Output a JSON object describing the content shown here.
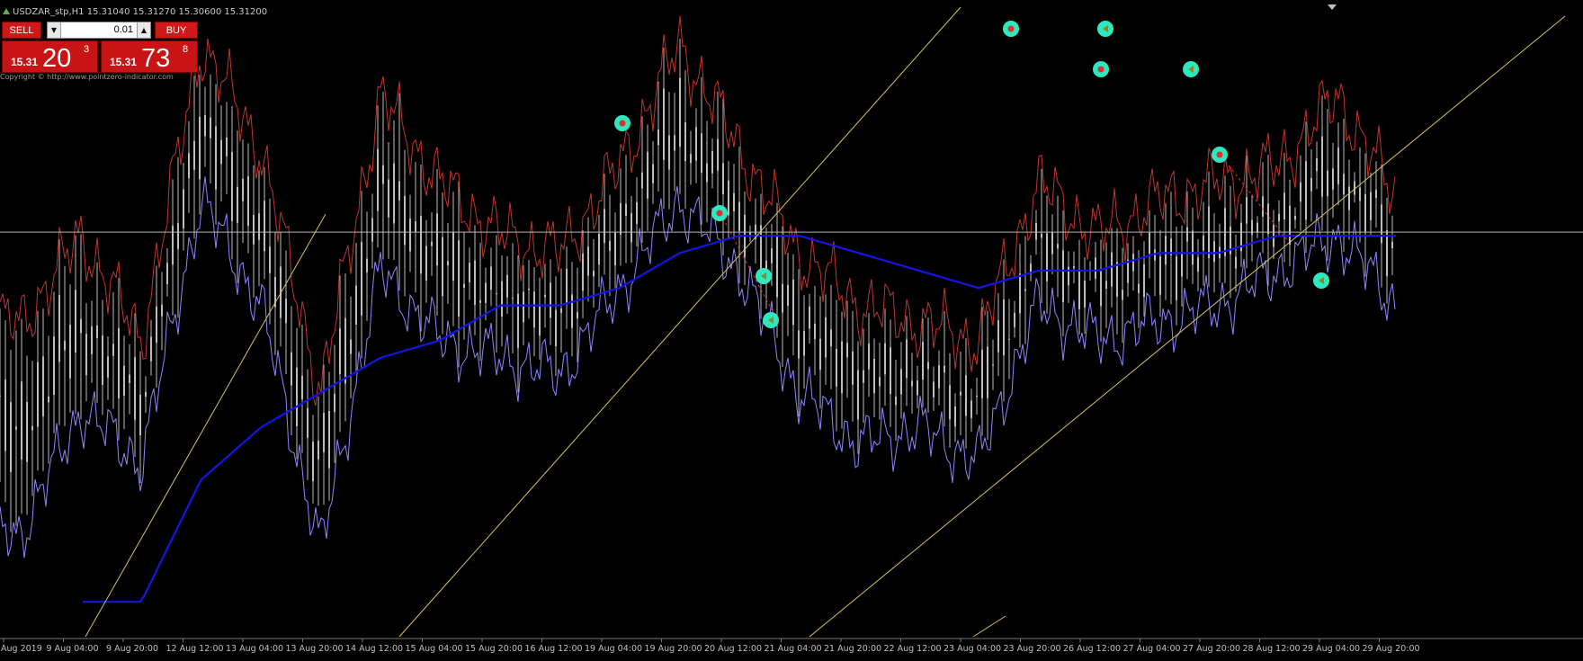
{
  "header": {
    "symbol_line": "USDZAR_stp,H1  15.31040 15.31270 15.30600 15.31200",
    "copyright": "Copyright © http://www.pointzero-indicator.com"
  },
  "trade_panel": {
    "sell_label": "SELL",
    "buy_label": "BUY",
    "lot_value": "0.01",
    "bid_prefix": "15.31",
    "bid_big": "20",
    "bid_sup": "3",
    "ask_prefix": "15.31",
    "ask_big": "73",
    "ask_sup": "8"
  },
  "colors": {
    "background": "#000000",
    "candles": "#bdbdbd",
    "upper_band": "#c0352b",
    "lower_band": "#8e86ff",
    "moving_average": "#1414e6",
    "trendlines": "#d8c35a",
    "signal_marker": "#2ee8c0",
    "signal_dot": "#e03030",
    "current_price_line": "#b4b4b4"
  },
  "chart_data": {
    "type": "line",
    "symbol": "USDZAR_stp",
    "timeframe": "H1",
    "x_ticks": [
      "Aug 2019",
      "9 Aug 04:00",
      "9 Aug 20:00",
      "12 Aug 12:00",
      "13 Aug 04:00",
      "13 Aug 20:00",
      "14 Aug 12:00",
      "15 Aug 04:00",
      "15 Aug 20:00",
      "16 Aug 12:00",
      "19 Aug 04:00",
      "19 Aug 20:00",
      "20 Aug 12:00",
      "21 Aug 04:00",
      "21 Aug 20:00",
      "22 Aug 12:00",
      "23 Aug 04:00",
      "23 Aug 20:00",
      "26 Aug 12:00",
      "27 Aug 04:00",
      "27 Aug 20:00",
      "28 Aug 12:00",
      "29 Aug 04:00",
      "29 Aug 20:00"
    ],
    "current_price": 15.312,
    "series": [
      {
        "name": "",
        "role": "upper band",
        "x": [
          "Aug 2019",
          "9 Aug 04:00",
          "9 Aug 20:00",
          "12 Aug 12:00",
          "13 Aug 04:00",
          "13 Aug 20:00",
          "14 Aug 12:00",
          "15 Aug 04:00",
          "15 Aug 20:00",
          "16 Aug 12:00",
          "19 Aug 04:00",
          "19 Aug 20:00",
          "20 Aug 12:00",
          "21 Aug 04:00",
          "21 Aug 20:00",
          "22 Aug 12:00",
          "23 Aug 04:00",
          "23 Aug 20:00",
          "26 Aug 12:00",
          "27 Aug 04:00",
          "27 Aug 20:00",
          "28 Aug 12:00",
          "29 Aug 04:00",
          "29 Aug 20:00"
        ],
        "values": [
          15.26,
          15.31,
          15.25,
          15.42,
          15.36,
          15.22,
          15.39,
          15.34,
          15.31,
          15.3,
          15.35,
          15.42,
          15.36,
          15.3,
          15.27,
          15.26,
          15.25,
          15.34,
          15.31,
          15.33,
          15.34,
          15.35,
          15.39,
          15.33
        ]
      },
      {
        "name": "",
        "role": "lower band",
        "x": [
          "Aug 2019",
          "9 Aug 04:00",
          "9 Aug 20:00",
          "12 Aug 12:00",
          "13 Aug 04:00",
          "13 Aug 20:00",
          "14 Aug 12:00",
          "15 Aug 04:00",
          "15 Aug 20:00",
          "16 Aug 12:00",
          "19 Aug 04:00",
          "19 Aug 20:00",
          "20 Aug 12:00",
          "21 Aug 04:00",
          "21 Aug 20:00",
          "22 Aug 12:00",
          "23 Aug 04:00",
          "23 Aug 20:00",
          "26 Aug 12:00",
          "27 Aug 04:00",
          "27 Aug 20:00",
          "28 Aug 12:00",
          "29 Aug 04:00",
          "29 Aug 20:00"
        ],
        "values": [
          15.14,
          15.21,
          15.18,
          15.33,
          15.27,
          15.13,
          15.29,
          15.25,
          15.24,
          15.23,
          15.28,
          15.33,
          15.29,
          15.22,
          15.19,
          15.2,
          15.18,
          15.27,
          15.25,
          15.26,
          15.27,
          15.29,
          15.31,
          15.27
        ]
      },
      {
        "name": "",
        "role": "moving average",
        "x": [
          "Aug 2019",
          "9 Aug 04:00",
          "9 Aug 20:00",
          "12 Aug 12:00",
          "13 Aug 04:00",
          "13 Aug 20:00",
          "14 Aug 12:00",
          "15 Aug 04:00",
          "15 Aug 20:00",
          "16 Aug 12:00",
          "19 Aug 04:00",
          "19 Aug 20:00",
          "20 Aug 12:00",
          "21 Aug 04:00",
          "21 Aug 20:00",
          "22 Aug 12:00",
          "23 Aug 04:00",
          "23 Aug 20:00",
          "26 Aug 12:00",
          "27 Aug 04:00",
          "27 Aug 20:00",
          "28 Aug 12:00",
          "29 Aug 04:00",
          "29 Aug 20:00"
        ],
        "values": [
          null,
          null,
          15.1,
          15.17,
          15.2,
          15.22,
          15.24,
          15.25,
          15.27,
          15.27,
          15.28,
          15.3,
          15.31,
          15.31,
          15.3,
          15.29,
          15.28,
          15.29,
          15.29,
          15.3,
          15.3,
          15.31,
          15.31,
          15.31
        ]
      }
    ],
    "grid": false,
    "legend": "none"
  }
}
